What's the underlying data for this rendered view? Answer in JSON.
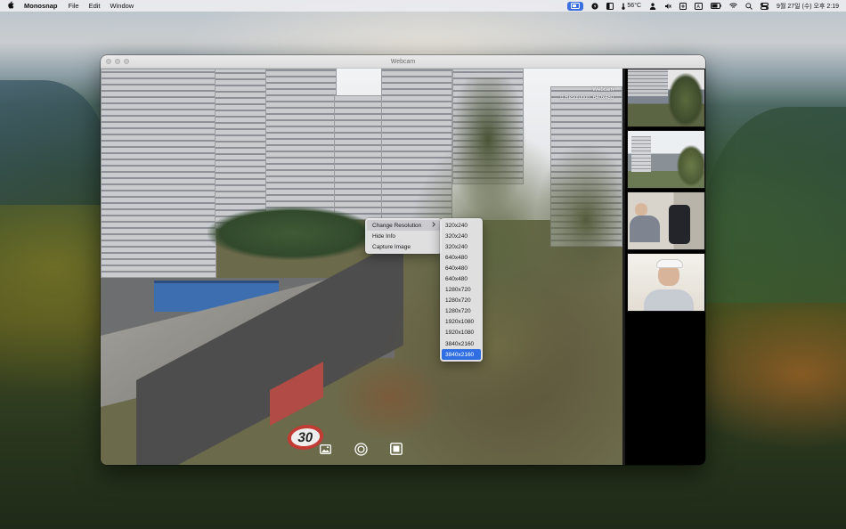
{
  "menubar": {
    "apple": "",
    "app_name": "Monosnap",
    "items": [
      "File",
      "Edit",
      "Window"
    ],
    "status": {
      "temperature": "56°C",
      "datetime": "9월 27일 (수) 오후 2:19"
    }
  },
  "window": {
    "title": "Webcam",
    "overlay": {
      "line1": "Webcam",
      "line2": "d Resolution: 640x480"
    }
  },
  "context_menu": {
    "items": [
      "Change Resolution",
      "Hide Info",
      "Capture Image"
    ],
    "highlighted_index": 0
  },
  "resolution_submenu": {
    "options": [
      "320x240",
      "320x240",
      "320x240",
      "640x480",
      "640x480",
      "640x480",
      "1280x720",
      "1280x720",
      "1280x720",
      "1920x1080",
      "1920x1080",
      "3840x2160",
      "3840x2160"
    ],
    "selected_index": 12
  },
  "scene": {
    "speed_sign": "30"
  },
  "colors": {
    "accent": "#2f6fe3",
    "menu_bg": "#e8e8ec"
  },
  "icons": {
    "photo": "photo-icon",
    "record": "record-icon",
    "stop": "stop-icon"
  }
}
